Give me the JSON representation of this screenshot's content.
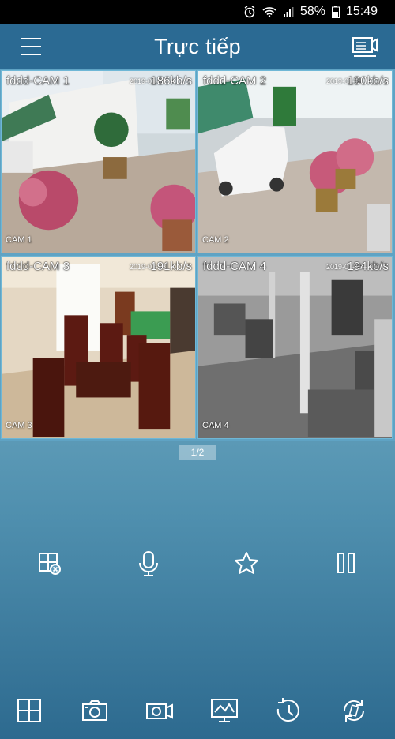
{
  "status_bar": {
    "battery": "58%",
    "time": "15:49"
  },
  "app_bar": {
    "title": "Trực tiếp"
  },
  "cameras": [
    {
      "name": "fddd-CAM 1",
      "rate": "186kb/s",
      "timestamp": "2019-03-18",
      "osd": "CAM 1"
    },
    {
      "name": "fddd-CAM 2",
      "rate": "190kb/s",
      "timestamp": "2019-03-18",
      "osd": "CAM 2"
    },
    {
      "name": "fddd-CAM 3",
      "rate": "191kb/s",
      "timestamp": "2019-03-18",
      "osd": "CAM 3"
    },
    {
      "name": "fddd-CAM 4",
      "rate": "194kb/s",
      "timestamp": "2019-03-18",
      "osd": "CAM 4"
    }
  ],
  "pager": {
    "label": "1/2"
  },
  "controls": [
    "close-split-icon",
    "microphone-icon",
    "star-icon",
    "pause-icon"
  ],
  "toolbar": [
    "grid-layout-icon",
    "camera-snapshot-icon",
    "video-record-icon",
    "monitor-chart-icon",
    "playback-history-icon",
    "refresh-icon"
  ],
  "colors": {
    "app_bar": "#2b6a93",
    "background_top": "#a8d4e0",
    "background_bottom": "#2d6a8f"
  }
}
